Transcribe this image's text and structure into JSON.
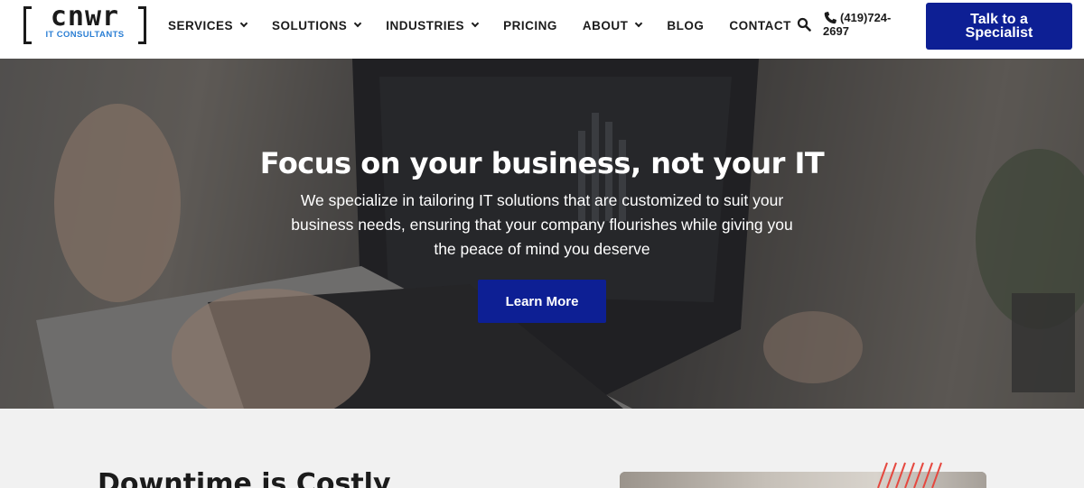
{
  "header": {
    "logo": {
      "word": "cnwr",
      "sub": "IT CONSULTANTS"
    },
    "nav": [
      {
        "label": "SERVICES",
        "has_dropdown": true
      },
      {
        "label": "SOLUTIONS",
        "has_dropdown": true
      },
      {
        "label": "INDUSTRIES",
        "has_dropdown": true
      },
      {
        "label": "PRICING",
        "has_dropdown": false
      },
      {
        "label": "ABOUT",
        "has_dropdown": true
      },
      {
        "label": "BLOG",
        "has_dropdown": false
      },
      {
        "label": "CONTACT",
        "has_dropdown": false
      }
    ],
    "search_icon": "search-icon",
    "phone": {
      "icon": "phone-icon",
      "number": "(419)724-2697"
    },
    "cta_label": "Talk to a Specialist"
  },
  "hero": {
    "title": "Focus on your business, not your IT",
    "subtitle": "We specialize in tailoring IT solutions that are customized to suit your business needs, ensuring that your company flourishes while giving you the peace of mind you deserve",
    "button_label": "Learn More"
  },
  "section": {
    "title": "Downtime is Costly"
  },
  "colors": {
    "brand_blue": "#0d1f94",
    "logo_accent": "#2b7fd4",
    "text_dark": "#1b1b1b",
    "accent_red": "#e5483f"
  }
}
